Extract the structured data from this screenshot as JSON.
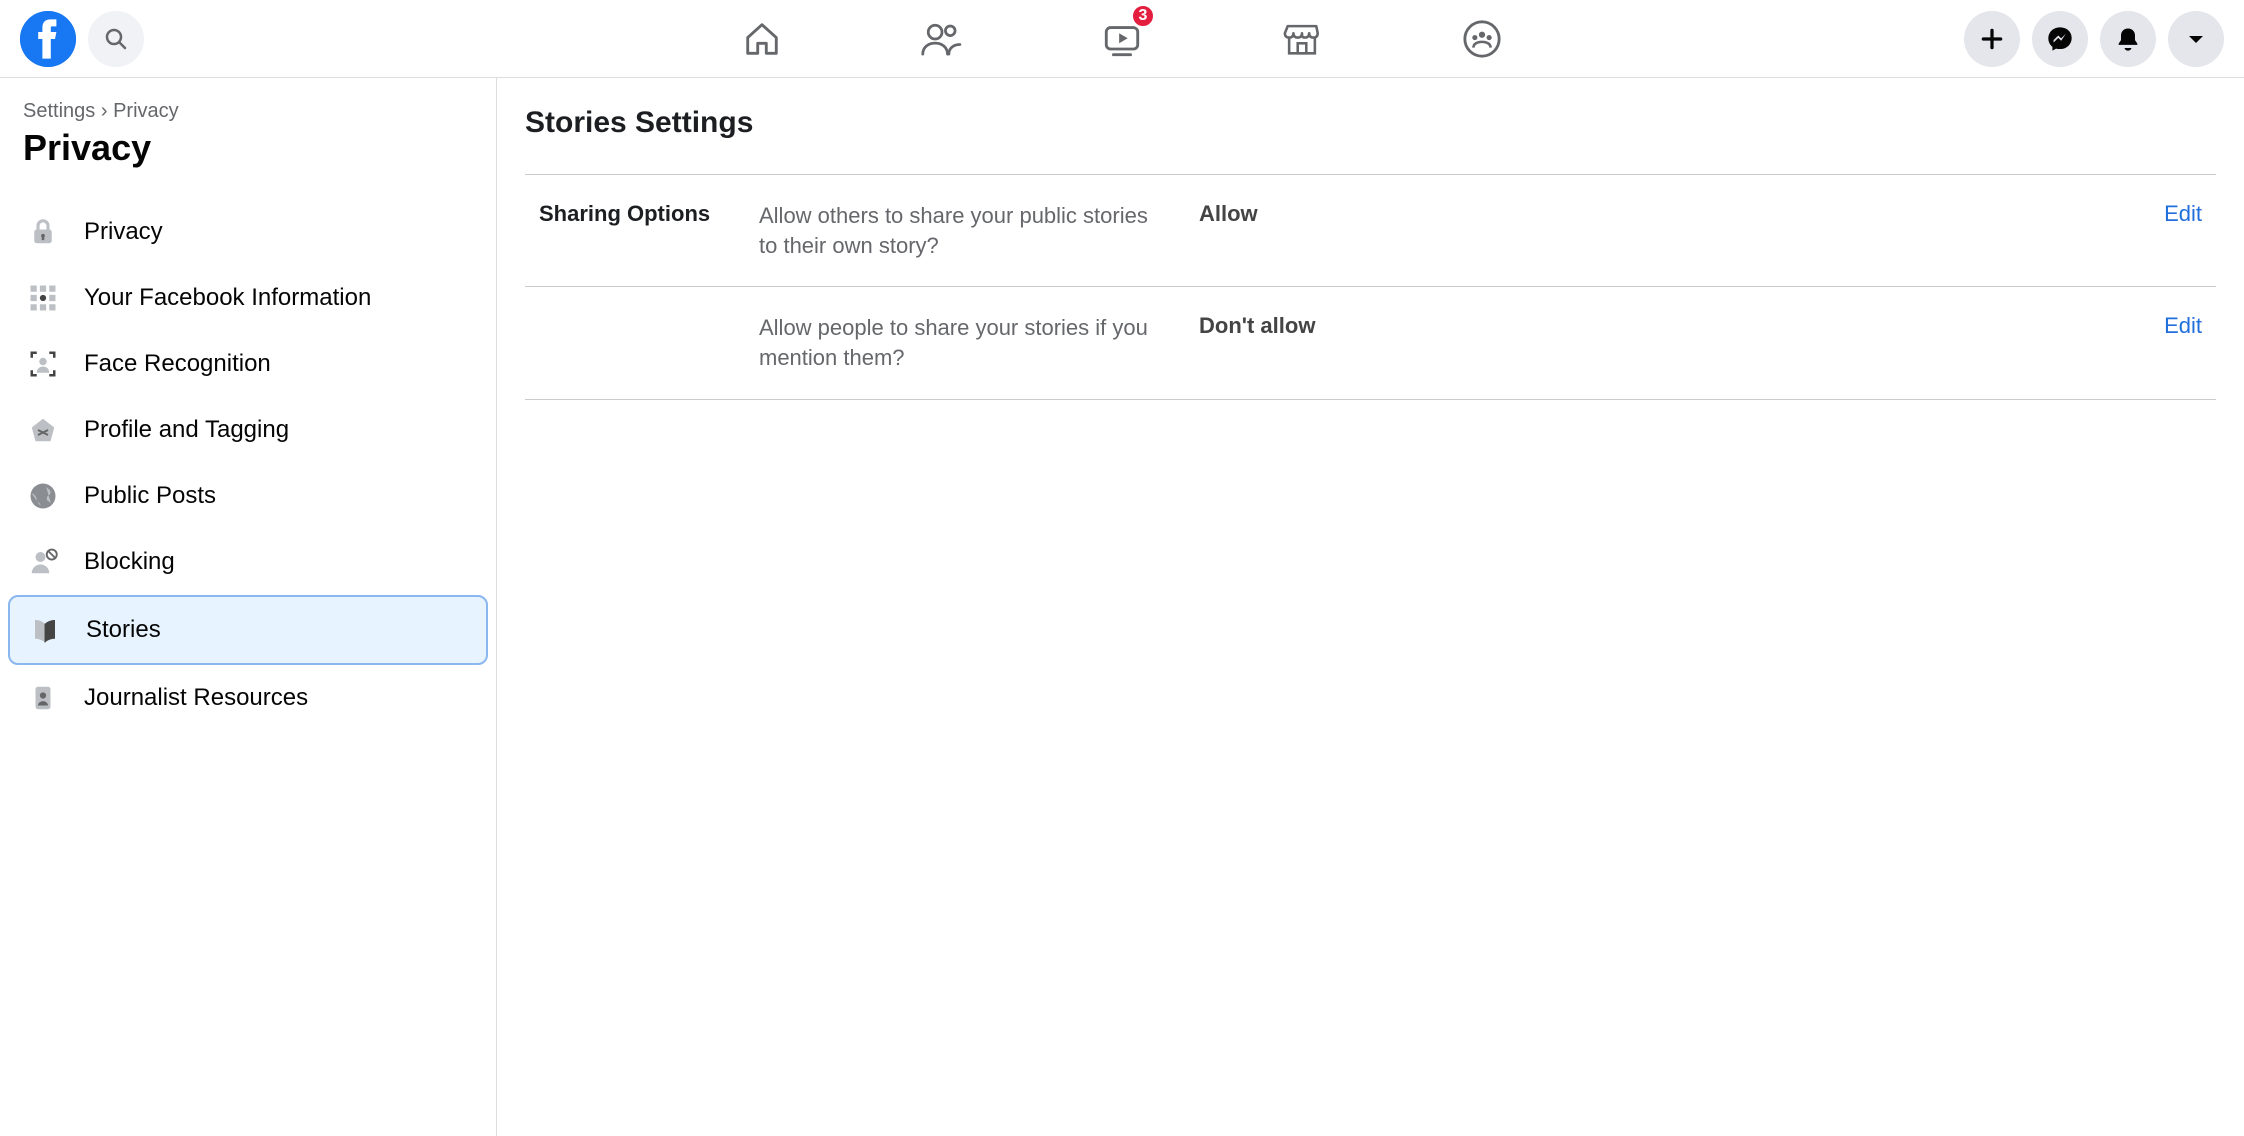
{
  "header": {
    "badge_watch": "3"
  },
  "breadcrumb": {
    "root": "Settings",
    "sep": "›",
    "current": "Privacy"
  },
  "sidebar": {
    "title": "Privacy",
    "items": [
      {
        "label": "Privacy"
      },
      {
        "label": "Your Facebook Information"
      },
      {
        "label": "Face Recognition"
      },
      {
        "label": "Profile and Tagging"
      },
      {
        "label": "Public Posts"
      },
      {
        "label": "Blocking"
      },
      {
        "label": "Stories"
      },
      {
        "label": "Journalist Resources"
      }
    ]
  },
  "main": {
    "title": "Stories Settings",
    "section_label": "Sharing Options",
    "rows": [
      {
        "desc": "Allow others to share your public stories to their own story?",
        "value": "Allow",
        "edit": "Edit"
      },
      {
        "desc": "Allow people to share your stories if you mention them?",
        "value": "Don't allow",
        "edit": "Edit"
      }
    ]
  }
}
